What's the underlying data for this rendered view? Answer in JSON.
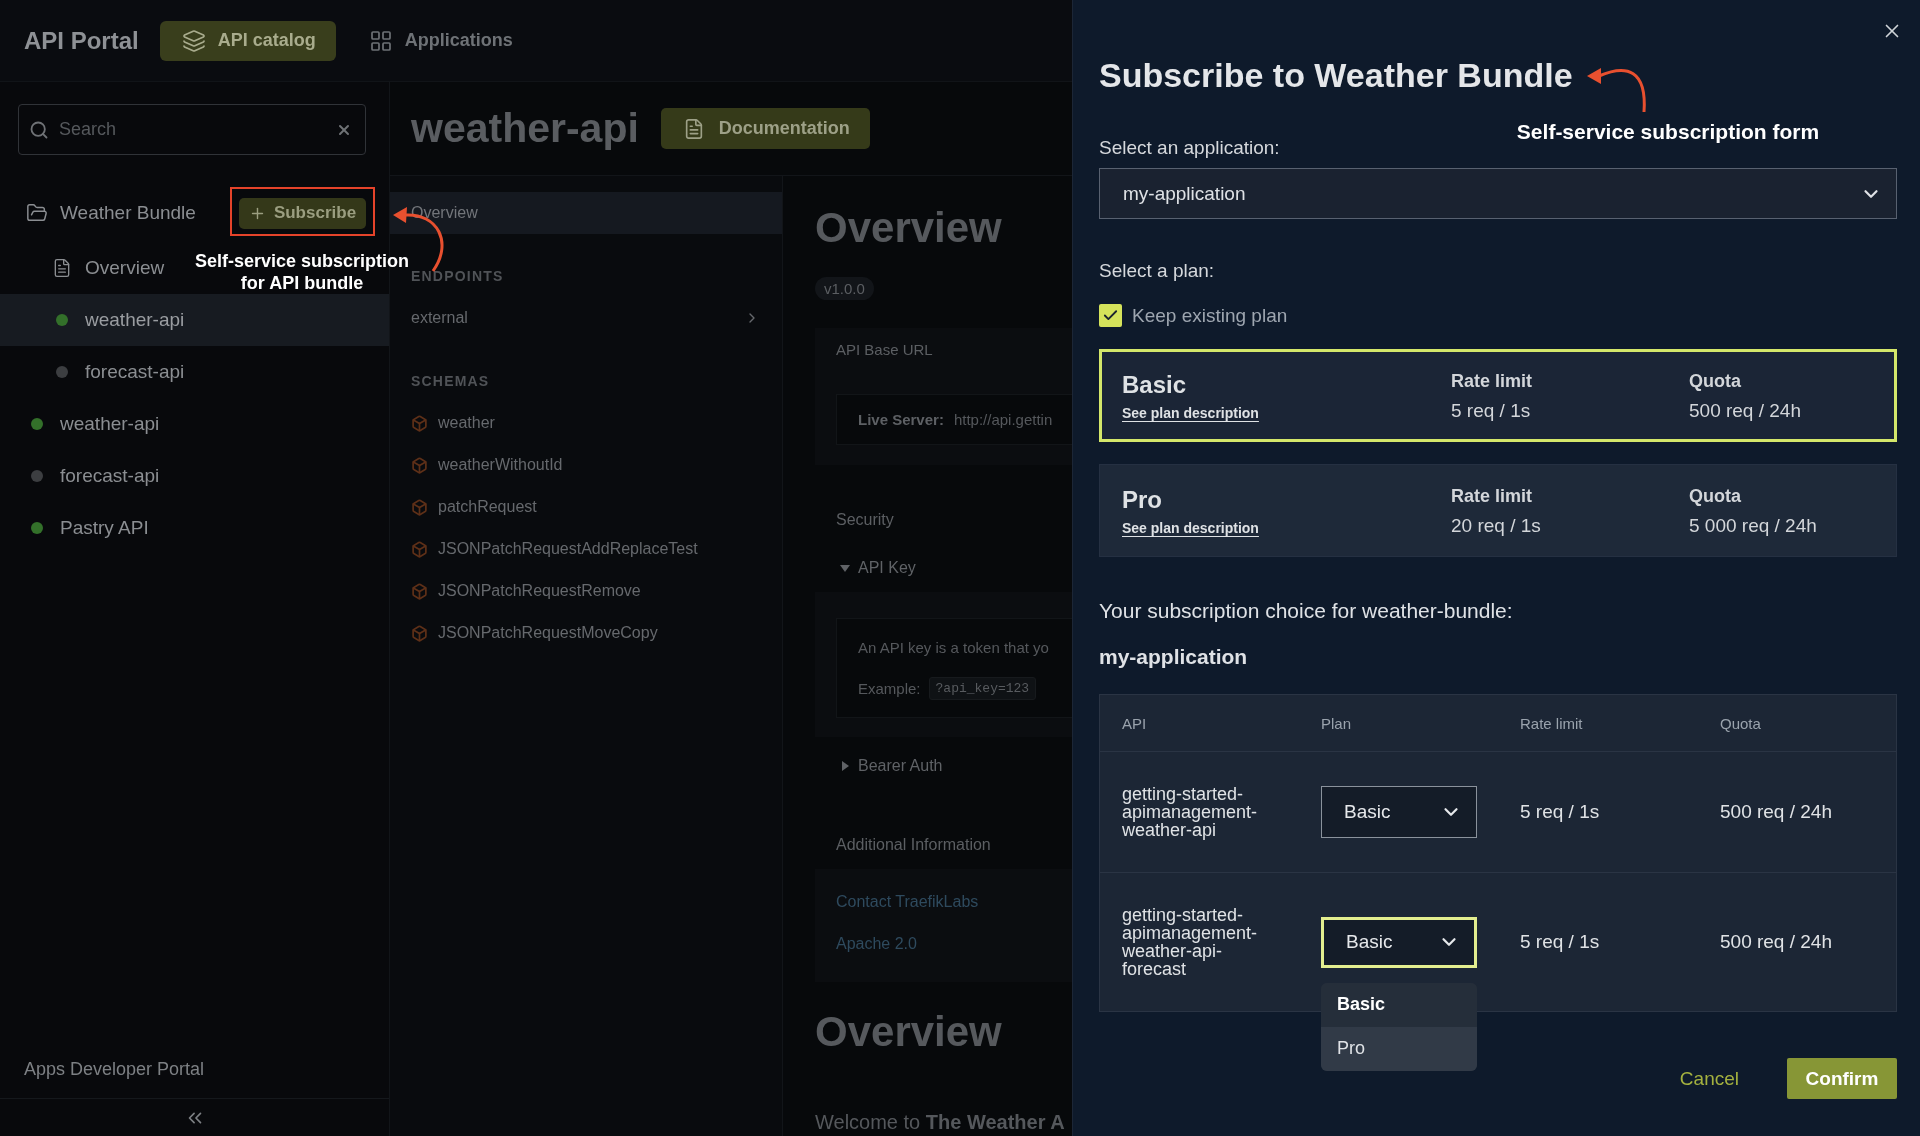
{
  "top_nav": {
    "brand": "API Portal",
    "tabs": [
      {
        "label": "API catalog",
        "selected": true
      },
      {
        "label": "Applications",
        "selected": false
      }
    ]
  },
  "sidebar": {
    "search": {
      "placeholder": "Search"
    },
    "tree": [
      {
        "label": "Weather Bundle",
        "kind": "bundle",
        "selected": false,
        "action": "Subscribe",
        "children": [
          {
            "label": "Overview",
            "kind": "page",
            "selected": false
          },
          {
            "label": "weather-api",
            "kind": "api",
            "selected": true,
            "color": "#33702a"
          },
          {
            "label": "forecast-api",
            "kind": "api",
            "selected": false,
            "color": "#3c3e41"
          }
        ]
      },
      {
        "label": "weather-api",
        "kind": "api",
        "selected": false,
        "color": "#33702a"
      },
      {
        "label": "forecast-api",
        "kind": "api",
        "selected": false,
        "color": "#3c3e41"
      },
      {
        "label": "Pastry API",
        "kind": "api",
        "selected": false,
        "color": "#33702a"
      }
    ],
    "footer": "Apps Developer Portal"
  },
  "api_header": {
    "title": "weather-api",
    "button": "Documentation"
  },
  "api_nav": {
    "links": [
      {
        "label": "Overview",
        "selected": true
      }
    ],
    "sections": [
      {
        "heading": "ENDPOINTS",
        "items": [
          {
            "label": "external",
            "kind": "group",
            "selected": false
          }
        ]
      },
      {
        "heading": "SCHEMAS",
        "items": [
          {
            "label": "weather",
            "kind": "schema",
            "selected": false
          },
          {
            "label": "weatherWithoutId",
            "kind": "schema",
            "selected": false
          },
          {
            "label": "patchRequest",
            "kind": "schema",
            "selected": false
          },
          {
            "label": "JSONPatchRequestAddReplaceTest",
            "kind": "schema",
            "selected": false
          },
          {
            "label": "JSONPatchRequestRemove",
            "kind": "schema",
            "selected": false
          },
          {
            "label": "JSONPatchRequestMoveCopy",
            "kind": "schema",
            "selected": false
          }
        ]
      }
    ]
  },
  "content": {
    "title": "Overview",
    "version": "v1.0.0",
    "base_url": {
      "heading": "API Base URL",
      "label": "Live Server:",
      "value": "http://api.gettin"
    },
    "security": {
      "heading": "Security",
      "schemes": [
        {
          "name": "API Key",
          "expanded": true,
          "description": "An API key is a token that yo",
          "example_label": "Example:",
          "example": "?api_key=123"
        },
        {
          "name": "Bearer Auth",
          "expanded": false
        }
      ]
    },
    "additional": {
      "heading": "Additional Information",
      "links": [
        "Contact TraefikLabs",
        "Apache 2.0"
      ]
    },
    "section_title": "Overview",
    "intro": "Welcome to **The Weather A**"
  },
  "modal": {
    "title": "Subscribe to Weather Bundle",
    "application": {
      "label": "Select an application:",
      "value": "my-application"
    },
    "plan": {
      "label": "Select a plan:",
      "keep_existing": {
        "label": "Keep existing plan",
        "checked": true
      },
      "options": [
        {
          "name": "Basic",
          "link": "See plan description",
          "rate_label": "Rate limit",
          "rate": "5 req / 1s",
          "quota_label": "Quota",
          "quota": "500 req / 24h",
          "selected": true
        },
        {
          "name": "Pro",
          "link": "See plan description",
          "rate_label": "Rate limit",
          "rate": "20 req / 1s",
          "quota_label": "Quota",
          "quota": "5 000 req / 24h",
          "selected": false
        }
      ]
    },
    "summary": {
      "heading": "Your subscription choice for weather-bundle:",
      "application": "my-application",
      "table": {
        "columns": [
          "API",
          "Plan",
          "Rate limit",
          "Quota"
        ],
        "rows": [
          {
            "api": "getting-started-apimanagement-weather-api",
            "plan": "Basic",
            "rate": "5 req / 1s",
            "quota": "500 req / 24h",
            "focused": false
          },
          {
            "api": "getting-started-apimanagement-weather-api-forecast",
            "plan": "Basic",
            "rate": "5 req / 1s",
            "quota": "500 req / 24h",
            "focused": true,
            "menu": [
              {
                "label": "Basic",
                "selected": true,
                "highlighted": false
              },
              {
                "label": "Pro",
                "selected": false,
                "highlighted": true
              }
            ]
          }
        ]
      }
    },
    "buttons": [
      {
        "label": "Cancel",
        "kind": "link"
      },
      {
        "label": "Confirm",
        "kind": "primary"
      }
    ]
  },
  "annotations": [
    {
      "lines": [
        "Self-service subscription",
        "for API bundle"
      ]
    },
    {
      "lines": [
        "Self-service subscription form"
      ]
    }
  ]
}
